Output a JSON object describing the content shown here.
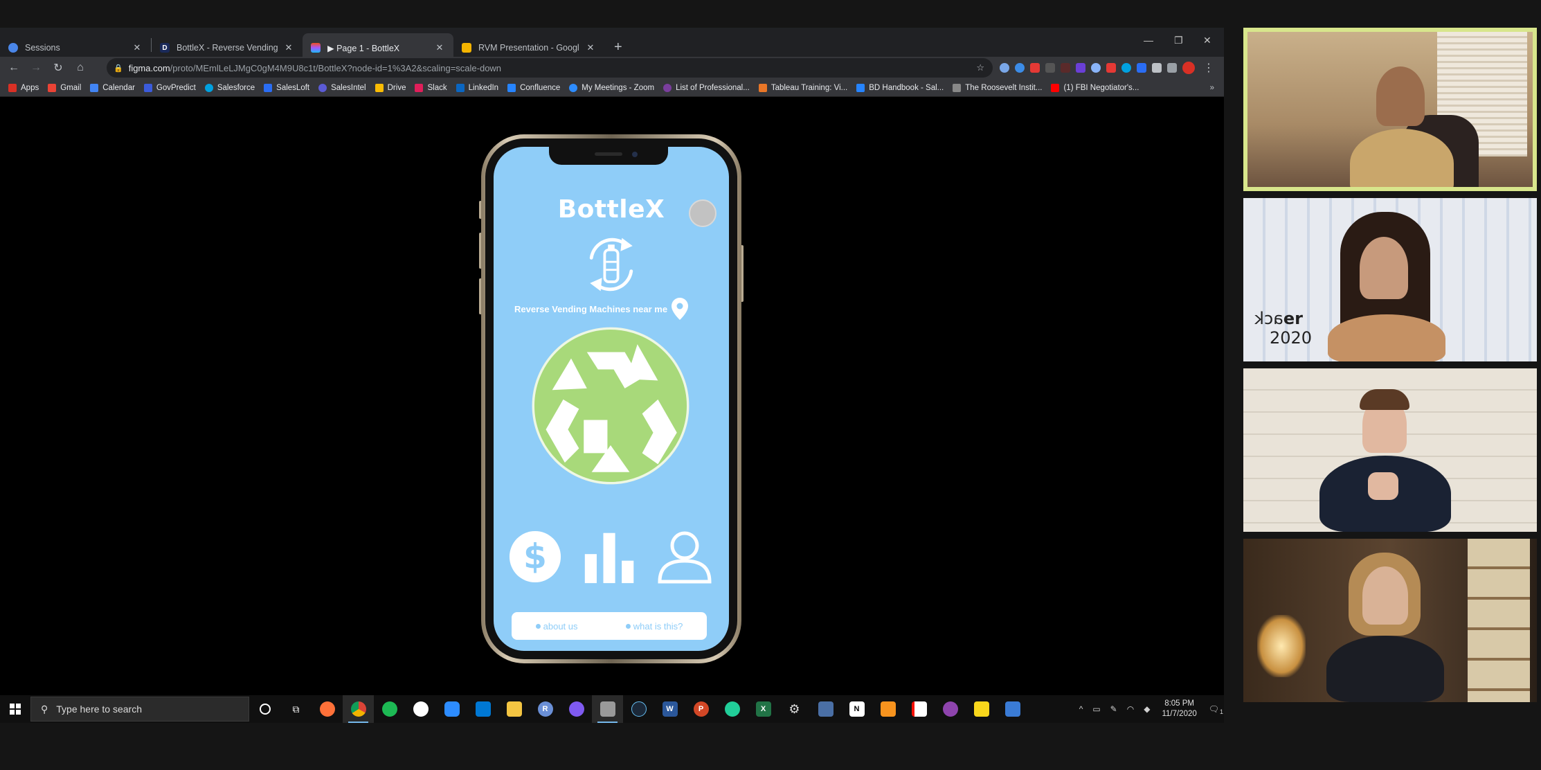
{
  "browser": {
    "tabs": [
      {
        "title": "Sessions",
        "active": false,
        "favicon_color": "#4a86e8"
      },
      {
        "title": "BottleX - Reverse Vending Machi",
        "active": false,
        "favicon_color": "#1a2a5a",
        "favicon_letter": "D"
      },
      {
        "title": "Page 1 - BottleX",
        "active": true,
        "favicon_color": "#f24e1e",
        "prefix": "▶ "
      },
      {
        "title": "RVM Presentation - Google Slide",
        "active": false,
        "favicon_color": "#f4b400"
      }
    ],
    "new_tab_label": "+",
    "url_domain": "figma.com",
    "url_path": "/proto/MEmlLeLJMgC0gM4M9U8c1t/BottleX?node-id=1%3A2&scaling=scale-down",
    "bookmarks": [
      {
        "label": "Apps",
        "color": "#d93025"
      },
      {
        "label": "Gmail",
        "color": "#ea4335"
      },
      {
        "label": "Calendar",
        "color": "#4285f4"
      },
      {
        "label": "GovPredict",
        "color": "#3b5bdb"
      },
      {
        "label": "Salesforce",
        "color": "#00a1e0"
      },
      {
        "label": "SalesLoft",
        "color": "#2a6df4"
      },
      {
        "label": "SalesIntel",
        "color": "#5b5bd6"
      },
      {
        "label": "Drive",
        "color": "#fbbc04"
      },
      {
        "label": "Slack",
        "color": "#e01e5a"
      },
      {
        "label": "LinkedIn",
        "color": "#0a66c2"
      },
      {
        "label": "Confluence",
        "color": "#2684ff"
      },
      {
        "label": "My Meetings - Zoom",
        "color": "#2d8cff"
      },
      {
        "label": "List of Professional...",
        "color": "#7a3e9d"
      },
      {
        "label": "Tableau Training: Vi...",
        "color": "#e97627"
      },
      {
        "label": "BD Handbook - Sal...",
        "color": "#2684ff"
      },
      {
        "label": "The Roosevelt Instit...",
        "color": "#888888"
      },
      {
        "label": "(1) FBI Negotiator's...",
        "color": "#ff0000"
      }
    ],
    "bookmarks_more": "»"
  },
  "app": {
    "title": "BottleX",
    "near_text": "Reverse Vending Machines near me",
    "footer_links": [
      "about us",
      "what is this?"
    ],
    "colors": {
      "background": "#8fcdf8",
      "recycle_green": "#a8d97a",
      "white": "#ffffff"
    },
    "tiles": [
      "dollar-icon",
      "bar-chart-icon",
      "user-icon"
    ]
  },
  "taskbar": {
    "search_placeholder": "Type here to search",
    "time": "8:05 PM",
    "date": "11/7/2020",
    "notification_count": "1",
    "apps": [
      {
        "name": "firefox-icon",
        "color": "#ff7139"
      },
      {
        "name": "chrome-icon",
        "color": "#4285f4",
        "running": true
      },
      {
        "name": "spotify-icon",
        "color": "#1db954"
      },
      {
        "name": "slack-icon",
        "color": "#ffffff"
      },
      {
        "name": "zoom-icon",
        "color": "#2d8cff"
      },
      {
        "name": "vscode-icon",
        "color": "#0078d4"
      },
      {
        "name": "file-explorer-icon",
        "color": "#f4c542"
      },
      {
        "name": "r-icon",
        "color": "#6a8fd6",
        "letter": "R"
      },
      {
        "name": "messenger-icon",
        "color": "#7f5af0"
      },
      {
        "name": "stack-icon",
        "color": "#9a9a9a",
        "running": true
      },
      {
        "name": "steam-icon",
        "color": "#1b2838"
      },
      {
        "name": "word-icon",
        "color": "#2b579a",
        "letter": "W"
      },
      {
        "name": "powerpoint-icon",
        "color": "#d24726",
        "letter": "P"
      },
      {
        "name": "robinhood-icon",
        "color": "#21ce99"
      },
      {
        "name": "excel-icon",
        "color": "#217346",
        "letter": "X"
      },
      {
        "name": "settings-icon",
        "color": "#cccccc"
      },
      {
        "name": "calculator-icon",
        "color": "#4a6fa5"
      },
      {
        "name": "notion-icon",
        "color": "#ffffff",
        "letter": "N"
      },
      {
        "name": "orange-app-icon",
        "color": "#f7931e"
      },
      {
        "name": "acrobat-icon",
        "color": "#f40f02"
      },
      {
        "name": "purple-app-icon",
        "color": "#8e44ad"
      },
      {
        "name": "sticky-notes-icon",
        "color": "#f9d71c"
      },
      {
        "name": "photos-icon",
        "color": "#3a7bd5"
      }
    ]
  },
  "video": {
    "participants": [
      {
        "name": "participant-1",
        "active": true
      },
      {
        "name": "participant-2",
        "active": false,
        "backdrop_text": [
          "ack",
          "er",
          "2020"
        ]
      },
      {
        "name": "participant-3",
        "active": false
      },
      {
        "name": "participant-4",
        "active": false
      }
    ]
  }
}
